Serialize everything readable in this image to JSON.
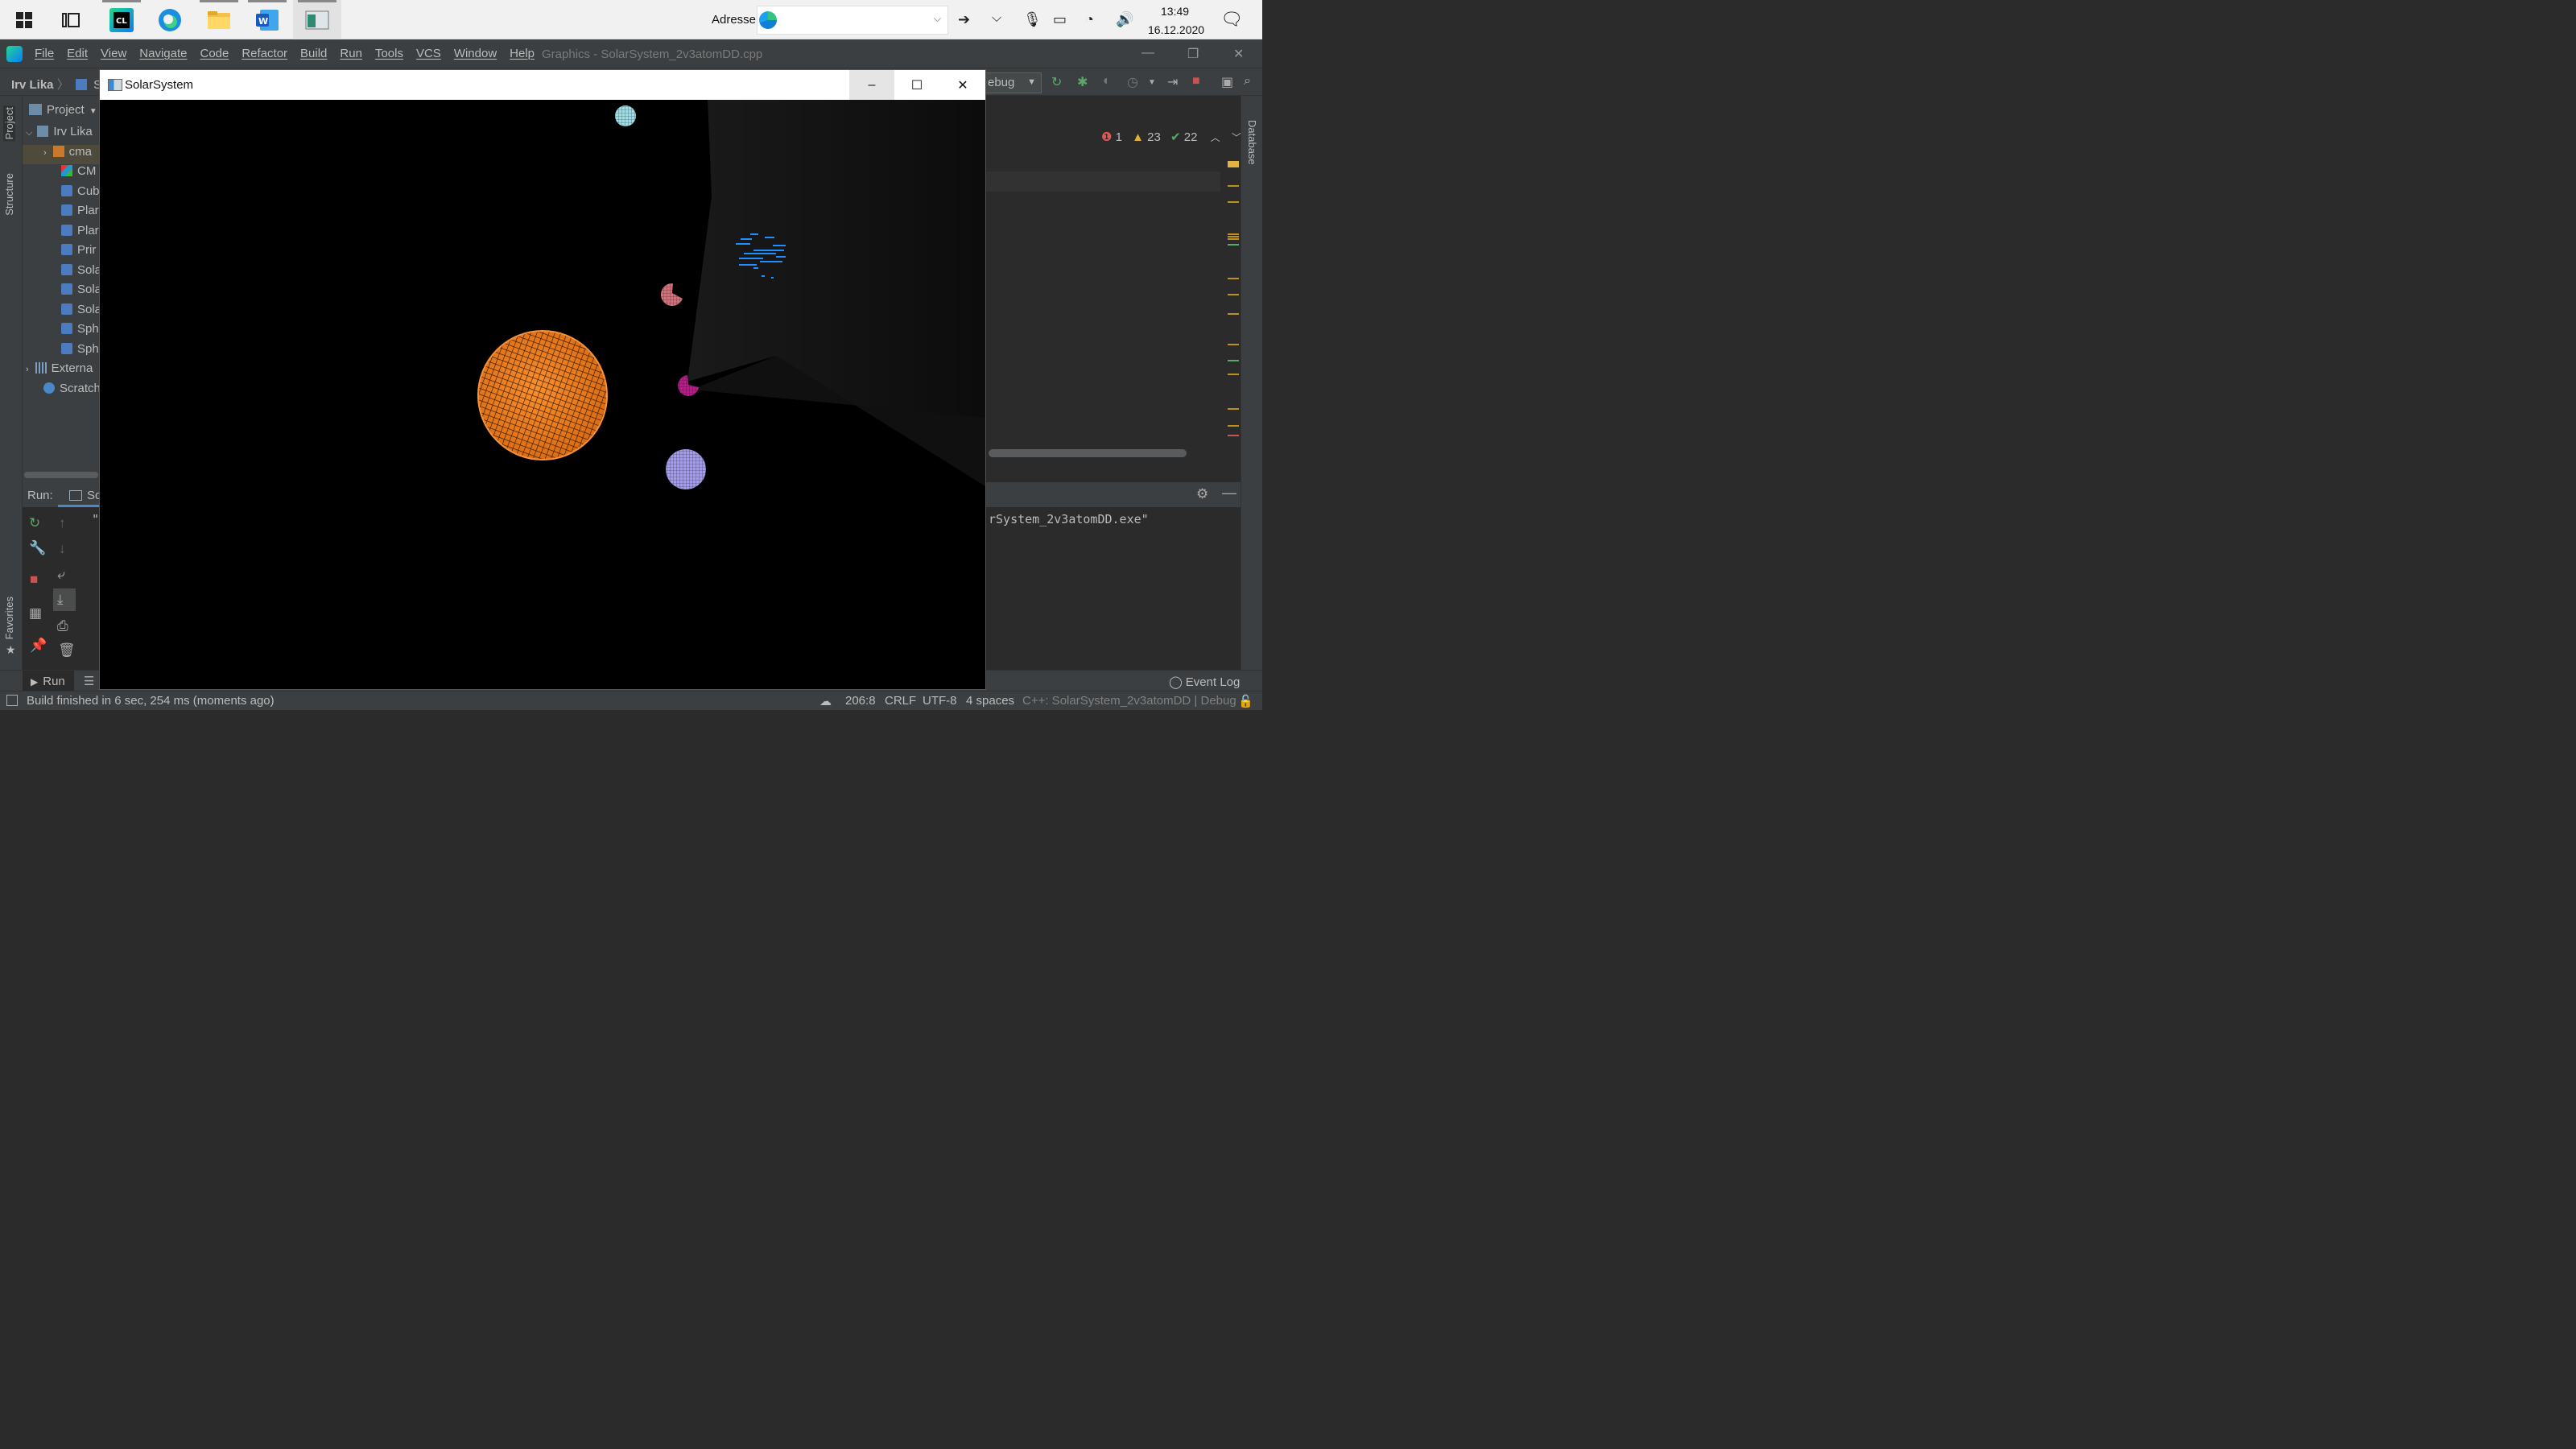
{
  "taskbar": {
    "apps": [
      {
        "name": "start",
        "icon": "windows-icon"
      },
      {
        "name": "task-view",
        "icon": "task-view-icon"
      },
      {
        "name": "clion",
        "icon": "clion-icon"
      },
      {
        "name": "edge",
        "icon": "edge-icon"
      },
      {
        "name": "file-explorer",
        "icon": "folder-icon"
      },
      {
        "name": "word",
        "icon": "word-icon"
      },
      {
        "name": "solarsystem",
        "icon": "app-window-icon"
      }
    ],
    "address_label": "Adresse",
    "address_value": "",
    "time": "13:49",
    "date": "16.12.2020"
  },
  "ide": {
    "menu": [
      "File",
      "Edit",
      "View",
      "Navigate",
      "Code",
      "Refactor",
      "Build",
      "Run",
      "Tools",
      "VCS",
      "Window",
      "Help"
    ],
    "title": "Graphics - SolarSystem_2v3atomDD.cpp",
    "breadcrumb_project": "Irv Lika",
    "breadcrumb_file": "So",
    "run_config": "ebug",
    "inspections": {
      "errors": "1",
      "warnings": "23",
      "ok": "22"
    },
    "side_tabs": {
      "project": "Project",
      "structure": "Structure",
      "favorites": "Favorites",
      "database": "Database"
    },
    "project_panel": {
      "header": "Project",
      "items": [
        {
          "label": "Irv Lika",
          "icon": "folder"
        },
        {
          "label": "cma",
          "icon": "folder-o"
        },
        {
          "label": "CM",
          "icon": "cmake"
        },
        {
          "label": "Cub",
          "icon": "cpp"
        },
        {
          "label": "Plar",
          "icon": "cpp"
        },
        {
          "label": "Plar",
          "icon": "cpp"
        },
        {
          "label": "Prir",
          "icon": "cpp"
        },
        {
          "label": "Sola",
          "icon": "cpp"
        },
        {
          "label": "Sola",
          "icon": "cpp"
        },
        {
          "label": "Sola",
          "icon": "cpp"
        },
        {
          "label": "Sph",
          "icon": "cpp"
        },
        {
          "label": "Sph",
          "icon": "cpp"
        },
        {
          "label": "Externa",
          "icon": "lib"
        },
        {
          "label": "Scratch",
          "icon": "scratch"
        }
      ]
    },
    "run_panel": {
      "label": "Run:",
      "tab": "Sc",
      "output_start": "\"",
      "output_end": "rSystem_2v3atomDD.exe\""
    },
    "tool_tabs": {
      "run": "Run",
      "event_log": "Event Log"
    },
    "status": {
      "message": "Build finished in 6 sec, 254 ms (moments ago)",
      "position": "206:8",
      "line_sep": "CRLF",
      "encoding": "UTF-8",
      "indent": "4 spaces",
      "context": "C++: SolarSystem_2v3atomDD | Debug"
    }
  },
  "app_window": {
    "title": "SolarSystem",
    "minimize": "–",
    "maximize": "☐",
    "close": "✕"
  },
  "scene": {
    "background": "#000000",
    "bodies": [
      {
        "name": "sun",
        "color": "#f07820"
      },
      {
        "name": "planet-cyan",
        "color": "#9cdde8"
      },
      {
        "name": "planet-pink",
        "color": "#d9707a"
      },
      {
        "name": "planet-magenta",
        "color": "#c0198f"
      },
      {
        "name": "planet-lavender",
        "color": "#a49cf0"
      },
      {
        "name": "particles-blue",
        "color": "#1f8fff"
      }
    ]
  }
}
